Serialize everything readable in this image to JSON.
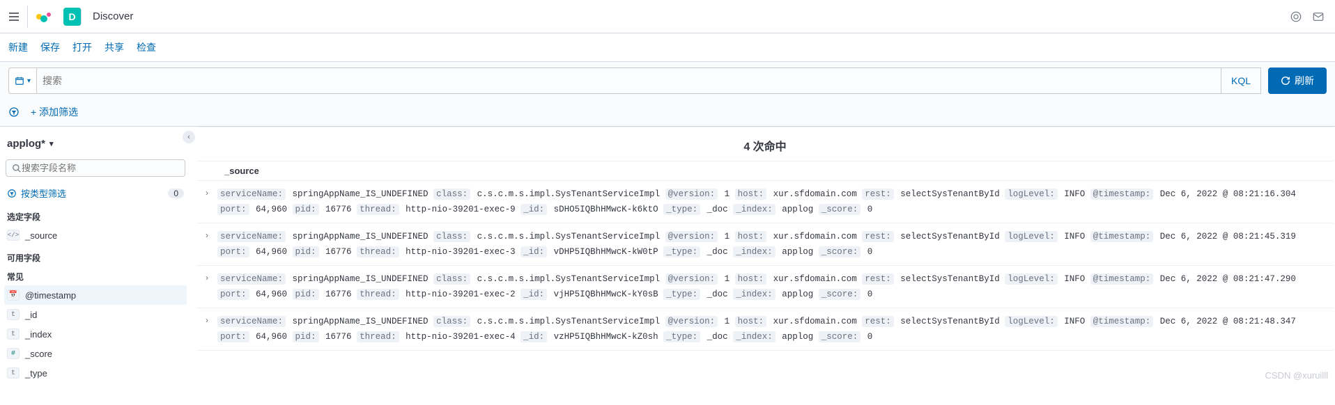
{
  "header": {
    "app_badge": "D",
    "app_name": "Discover"
  },
  "toolbar": {
    "new_": "新建",
    "save": "保存",
    "open": "打开",
    "share": "共享",
    "inspect": "检查"
  },
  "search": {
    "placeholder": "搜索",
    "kql": "KQL",
    "refresh": "刷新"
  },
  "filter": {
    "add": "+ 添加筛选"
  },
  "sidebar": {
    "index": "applog*",
    "field_search_placeholder": "搜索字段名称",
    "type_filter_label": "按类型筛选",
    "type_filter_count": "0",
    "section_selected": "选定字段",
    "section_available": "可用字段",
    "section_common": "常见",
    "selected": [
      {
        "type": "code",
        "glyph": "</>",
        "name": "_source"
      }
    ],
    "common": [
      {
        "type": "date",
        "glyph": "📅",
        "name": "@timestamp"
      }
    ],
    "available": [
      {
        "type": "t",
        "glyph": "t",
        "name": "_id"
      },
      {
        "type": "t",
        "glyph": "t",
        "name": "_index"
      },
      {
        "type": "num",
        "glyph": "#",
        "name": "_score"
      },
      {
        "type": "t",
        "glyph": "t",
        "name": "_type"
      }
    ]
  },
  "results": {
    "hits_label": "4 次命中",
    "source_col": "_source",
    "keys": {
      "serviceName": "serviceName:",
      "class": "class:",
      "version": "@version:",
      "host": "host:",
      "rest": "rest:",
      "logLevel": "logLevel:",
      "timestamp": "@timestamp:",
      "port": "port:",
      "pid": "pid:",
      "thread": "thread:",
      "id": "_id:",
      "type": "_type:",
      "index": "_index:",
      "score": "_score:"
    },
    "docs": [
      {
        "serviceName": "springAppName_IS_UNDEFINED",
        "class": "c.s.c.m.s.impl.SysTenantServiceImpl",
        "version": "1",
        "host": "xur.sfdomain.com",
        "rest": "selectSysTenantById",
        "logLevel": "INFO",
        "timestamp": "Dec 6, 2022 @ 08:21:16.304",
        "port": "64,960",
        "pid": "16776",
        "thread": "http-nio-39201-exec-9",
        "id": "sDHO5IQBhHMwcK-k6ktO",
        "type": "_doc",
        "index": "applog",
        "score": "0"
      },
      {
        "serviceName": "springAppName_IS_UNDEFINED",
        "class": "c.s.c.m.s.impl.SysTenantServiceImpl",
        "version": "1",
        "host": "xur.sfdomain.com",
        "rest": "selectSysTenantById",
        "logLevel": "INFO",
        "timestamp": "Dec 6, 2022 @ 08:21:45.319",
        "port": "64,960",
        "pid": "16776",
        "thread": "http-nio-39201-exec-3",
        "id": "vDHP5IQBhHMwcK-kW0tP",
        "type": "_doc",
        "index": "applog",
        "score": "0"
      },
      {
        "serviceName": "springAppName_IS_UNDEFINED",
        "class": "c.s.c.m.s.impl.SysTenantServiceImpl",
        "version": "1",
        "host": "xur.sfdomain.com",
        "rest": "selectSysTenantById",
        "logLevel": "INFO",
        "timestamp": "Dec 6, 2022 @ 08:21:47.290",
        "port": "64,960",
        "pid": "16776",
        "thread": "http-nio-39201-exec-2",
        "id": "vjHP5IQBhHMwcK-kY0sB",
        "type": "_doc",
        "index": "applog",
        "score": "0"
      },
      {
        "serviceName": "springAppName_IS_UNDEFINED",
        "class": "c.s.c.m.s.impl.SysTenantServiceImpl",
        "version": "1",
        "host": "xur.sfdomain.com",
        "rest": "selectSysTenantById",
        "logLevel": "INFO",
        "timestamp": "Dec 6, 2022 @ 08:21:48.347",
        "port": "64,960",
        "pid": "16776",
        "thread": "http-nio-39201-exec-4",
        "id": "vzHP5IQBhHMwcK-kZ0sh",
        "type": "_doc",
        "index": "applog",
        "score": "0"
      }
    ]
  },
  "watermark": "CSDN @xuruilll"
}
